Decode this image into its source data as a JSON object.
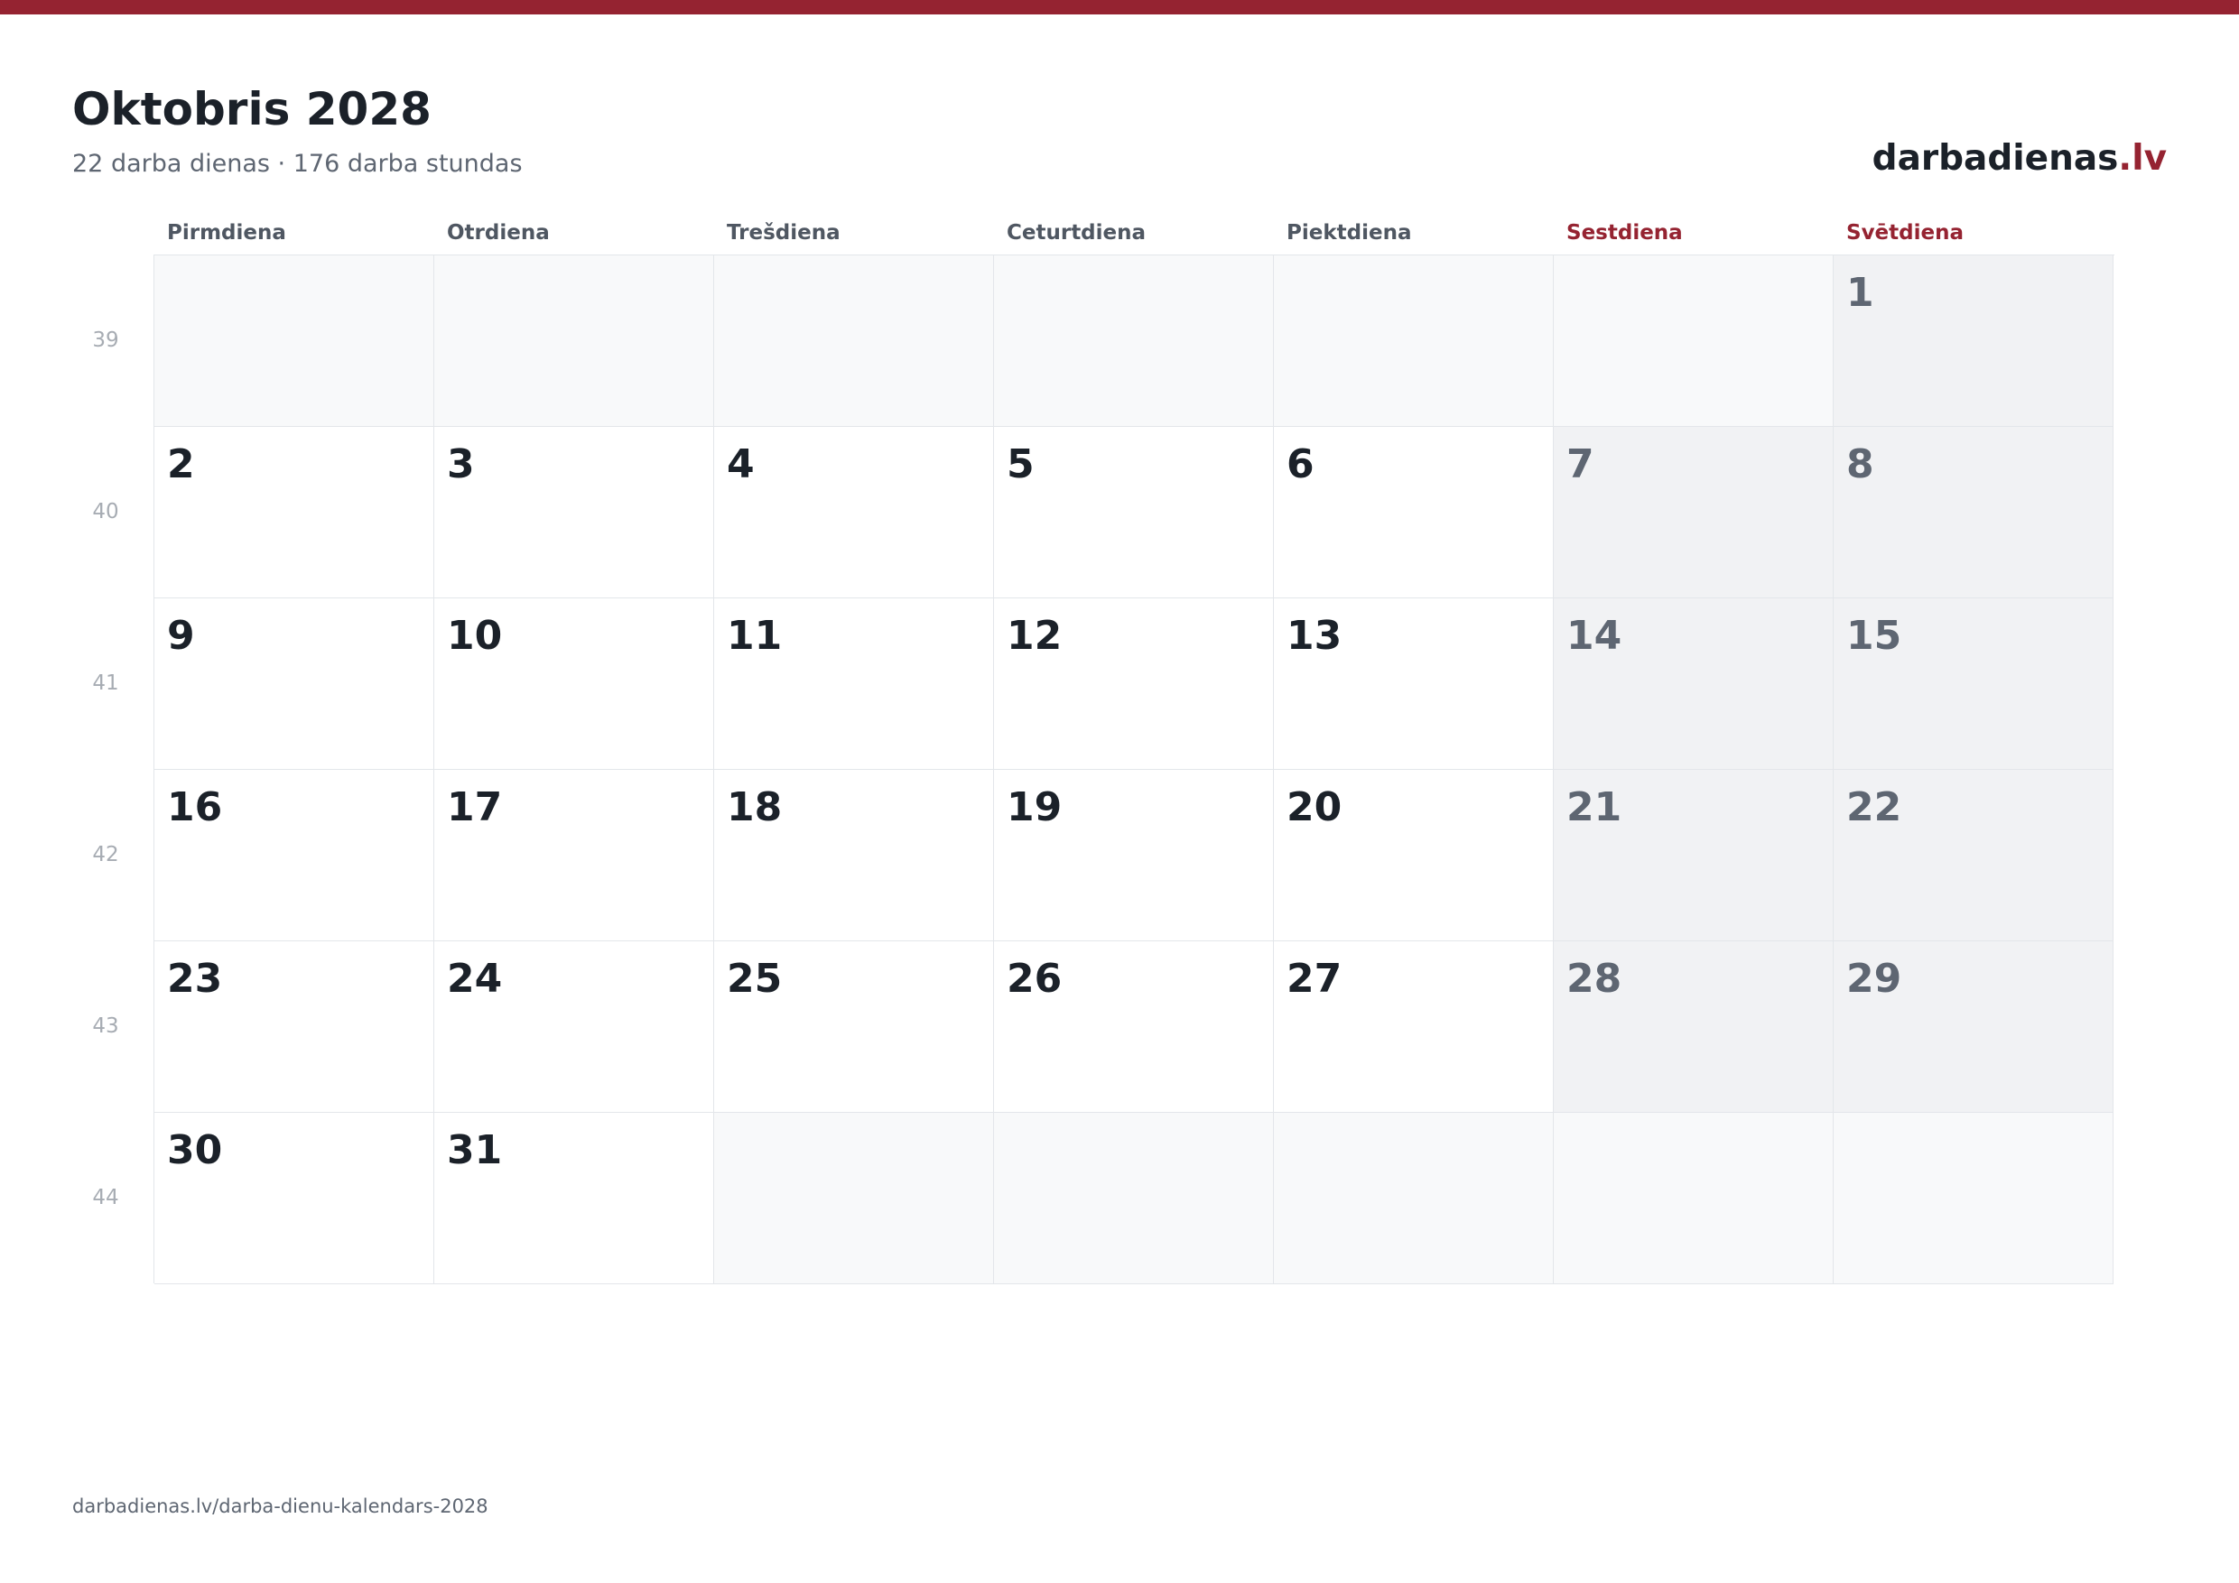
{
  "colors": {
    "accent": "#952331",
    "text_dark": "#1b2129",
    "text_muted": "#5e6672",
    "weekend_cell_bg": "#f1f2f4",
    "empty_cell_bg": "#f8f9fa",
    "grid_line": "#e3e6ea"
  },
  "header": {
    "title": "Oktobris 2028",
    "subtitle": "22 darba dienas · 176 darba stundas"
  },
  "logo": {
    "name": "darbadienas",
    "tld": ".lv"
  },
  "weekdays": [
    "Pirmdiena",
    "Otrdiena",
    "Trešdiena",
    "Ceturtdiena",
    "Piektdiena",
    "Sestdiena",
    "Svētdiena"
  ],
  "weeks": [
    {
      "number": "39",
      "days": [
        "",
        "",
        "",
        "",
        "",
        "",
        "1"
      ]
    },
    {
      "number": "40",
      "days": [
        "2",
        "3",
        "4",
        "5",
        "6",
        "7",
        "8"
      ]
    },
    {
      "number": "41",
      "days": [
        "9",
        "10",
        "11",
        "12",
        "13",
        "14",
        "15"
      ]
    },
    {
      "number": "42",
      "days": [
        "16",
        "17",
        "18",
        "19",
        "20",
        "21",
        "22"
      ]
    },
    {
      "number": "43",
      "days": [
        "23",
        "24",
        "25",
        "26",
        "27",
        "28",
        "29"
      ]
    },
    {
      "number": "44",
      "days": [
        "30",
        "31",
        "",
        "",
        "",
        "",
        ""
      ]
    }
  ],
  "footer": {
    "url": "darbadienas.lv/darba-dienu-kalendars-2028"
  }
}
